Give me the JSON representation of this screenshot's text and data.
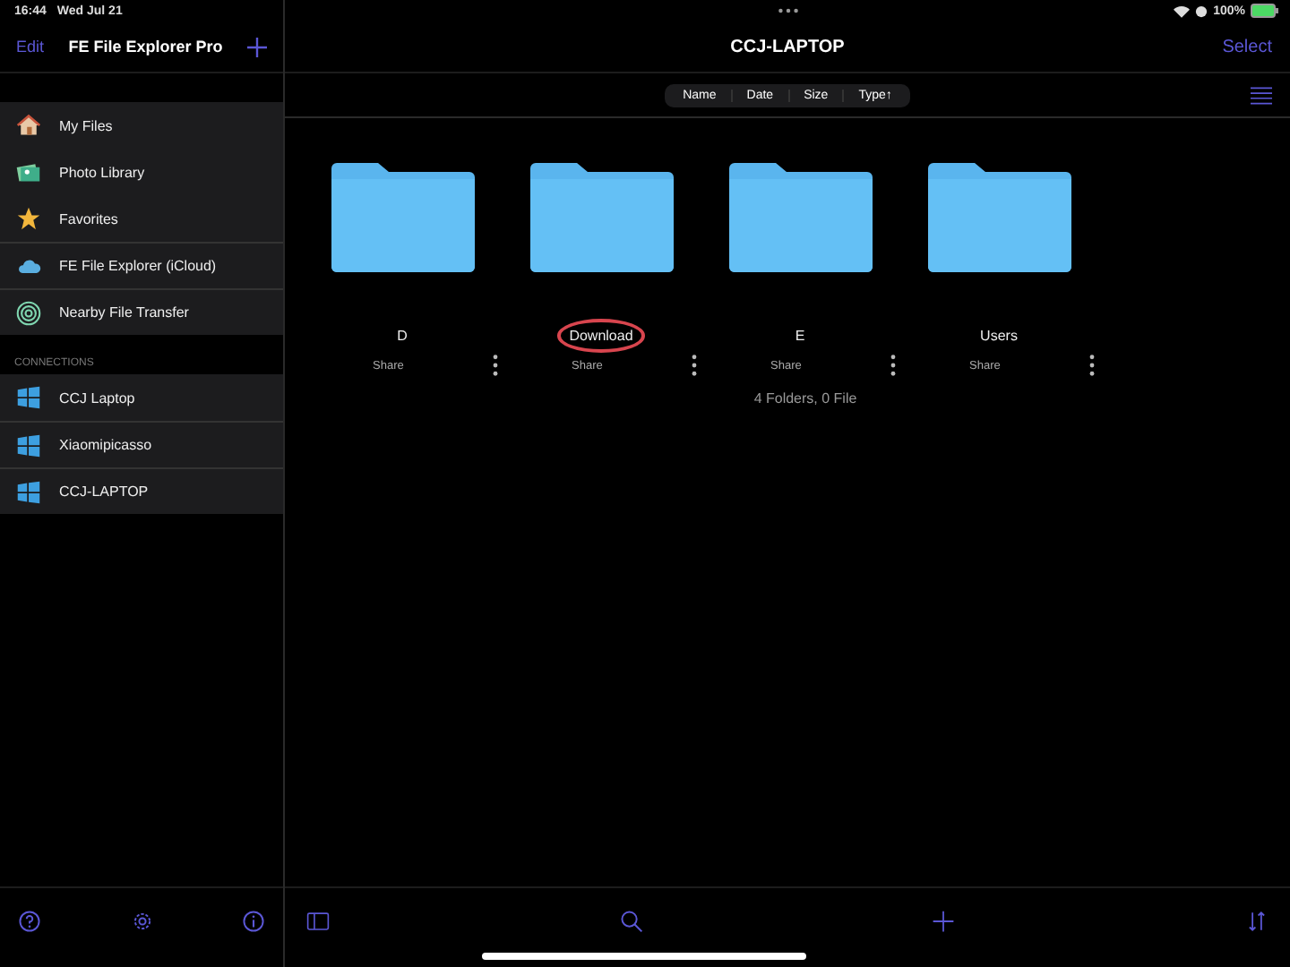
{
  "status_bar": {
    "time": "16:44",
    "date": "Wed Jul 21",
    "battery": "100%"
  },
  "sidebar": {
    "edit": "Edit",
    "title": "FE File Explorer Pro",
    "items": [
      {
        "label": "My Files",
        "kind": "house"
      },
      {
        "label": "Photo Library",
        "kind": "photo"
      },
      {
        "label": "Favorites",
        "kind": "star"
      },
      {
        "label": "FE File Explorer (iCloud)",
        "kind": "cloud"
      },
      {
        "label": "Nearby File Transfer",
        "kind": "nearby"
      }
    ],
    "connections_heading": "CONNECTIONS",
    "connections": [
      {
        "label": "CCJ Laptop"
      },
      {
        "label": "Xiaomipicasso"
      },
      {
        "label": "CCJ-LAPTOP"
      }
    ]
  },
  "main": {
    "title": "CCJ-LAPTOP",
    "select": "Select",
    "sort": [
      {
        "label": "Name"
      },
      {
        "label": "Date"
      },
      {
        "label": "Size"
      },
      {
        "label": "Type↑"
      }
    ],
    "folders": [
      {
        "name": "D",
        "share": "Share",
        "circled": false
      },
      {
        "name": "Download",
        "share": "Share",
        "circled": true
      },
      {
        "name": "E",
        "share": "Share",
        "circled": false
      },
      {
        "name": "Users",
        "share": "Share",
        "circled": false
      }
    ],
    "summary": "4 Folders, 0 File"
  }
}
